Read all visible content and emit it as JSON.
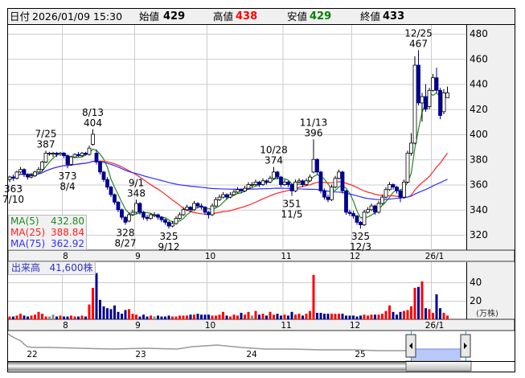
{
  "header": {
    "date_label": "日付",
    "datetime": "2026/01/09 15:30",
    "open_label": "始値",
    "open": "429",
    "high_label": "高値",
    "high": "438",
    "low_label": "安値",
    "low": "429",
    "close_label": "終値",
    "close": "433"
  },
  "colors": {
    "up": "#ff0000",
    "down": "#000090",
    "flat": "#888888",
    "ma5": "#228822",
    "ma25": "#ff2020",
    "ma75": "#3030ff",
    "high_text": "#ff0000",
    "low_text": "#008000"
  },
  "legend": {
    "ma5_label": "MA(5)",
    "ma5": "432.80",
    "ma25_label": "MA(25)",
    "ma25": "388.84",
    "ma75_label": "MA(75)",
    "ma75": "362.92"
  },
  "volume_legend": {
    "label": "出来高",
    "value": "41,600株"
  },
  "chart_data": {
    "type": "candlestick",
    "price_axis": {
      "ticks": [
        480,
        460,
        440,
        420,
        400,
        380,
        360,
        340,
        320
      ],
      "ylim": [
        320,
        480
      ]
    },
    "volume_axis": {
      "ticks": [
        40,
        20
      ],
      "unit": "(万株)"
    },
    "month_ticks": [
      {
        "label": "8",
        "index": 15
      },
      {
        "label": "9",
        "index": 35
      },
      {
        "label": "10",
        "index": 55
      },
      {
        "label": "11",
        "index": 76
      },
      {
        "label": "12",
        "index": 95
      },
      {
        "label": "26/1",
        "index": 117
      }
    ],
    "grid": true,
    "candles": [
      [
        364,
        367,
        362,
        366
      ],
      [
        366,
        368,
        363,
        365
      ],
      [
        365,
        371,
        364,
        370
      ],
      [
        370,
        374,
        369,
        372
      ],
      [
        372,
        373,
        366,
        368
      ],
      [
        368,
        369,
        364,
        366
      ],
      [
        366,
        369,
        365,
        367
      ],
      [
        367,
        371,
        366,
        370
      ],
      [
        370,
        374,
        369,
        372
      ],
      [
        372,
        379,
        371,
        378
      ],
      [
        378,
        387,
        377,
        385
      ],
      [
        385,
        386,
        383,
        385
      ],
      [
        385,
        386,
        382,
        385
      ],
      [
        385,
        386,
        382,
        384
      ],
      [
        384,
        386,
        383,
        385
      ],
      [
        385,
        386,
        381,
        383
      ],
      [
        383,
        384,
        373,
        376
      ],
      [
        376,
        383,
        375,
        382
      ],
      [
        382,
        385,
        381,
        384
      ],
      [
        384,
        386,
        382,
        383
      ],
      [
        383,
        386,
        382,
        385
      ],
      [
        385,
        386,
        383,
        384
      ],
      [
        384,
        391,
        383,
        389
      ],
      [
        392,
        404,
        391,
        400
      ],
      [
        385,
        388,
        376,
        378
      ],
      [
        378,
        379,
        368,
        370
      ],
      [
        370,
        371,
        362,
        364
      ],
      [
        364,
        366,
        356,
        358
      ],
      [
        358,
        359,
        350,
        352
      ],
      [
        352,
        353,
        344,
        346
      ],
      [
        346,
        347,
        338,
        340
      ],
      [
        340,
        341,
        332,
        334
      ],
      [
        334,
        335,
        328,
        330
      ],
      [
        331,
        338,
        330,
        336
      ],
      [
        336,
        340,
        335,
        338
      ],
      [
        338,
        348,
        337,
        345
      ],
      [
        345,
        346,
        336,
        338
      ],
      [
        338,
        339,
        332,
        334
      ],
      [
        334,
        336,
        331,
        333
      ],
      [
        333,
        337,
        332,
        336
      ],
      [
        336,
        338,
        334,
        336
      ],
      [
        336,
        337,
        332,
        334
      ],
      [
        334,
        335,
        330,
        332
      ],
      [
        332,
        333,
        328,
        330
      ],
      [
        330,
        331,
        325,
        327
      ],
      [
        327,
        331,
        326,
        329
      ],
      [
        329,
        335,
        328,
        333
      ],
      [
        333,
        338,
        332,
        336
      ],
      [
        336,
        342,
        335,
        340
      ],
      [
        340,
        344,
        339,
        342
      ],
      [
        342,
        343,
        338,
        340
      ],
      [
        340,
        347,
        339,
        345
      ],
      [
        345,
        346,
        341,
        343
      ],
      [
        343,
        345,
        340,
        342
      ],
      [
        342,
        343,
        336,
        338
      ],
      [
        338,
        339,
        333,
        336
      ],
      [
        336,
        345,
        335,
        343
      ],
      [
        343,
        350,
        342,
        348
      ],
      [
        348,
        352,
        347,
        350
      ],
      [
        350,
        354,
        349,
        352
      ],
      [
        352,
        353,
        348,
        350
      ],
      [
        350,
        354,
        349,
        352
      ],
      [
        352,
        356,
        351,
        354
      ],
      [
        354,
        358,
        353,
        356
      ],
      [
        356,
        357,
        353,
        355
      ],
      [
        355,
        359,
        354,
        357
      ],
      [
        357,
        362,
        356,
        360
      ],
      [
        360,
        362,
        358,
        360
      ],
      [
        360,
        364,
        359,
        362
      ],
      [
        362,
        363,
        358,
        360
      ],
      [
        360,
        365,
        359,
        363
      ],
      [
        363,
        364,
        360,
        362
      ],
      [
        362,
        367,
        361,
        365
      ],
      [
        365,
        374,
        364,
        370
      ],
      [
        370,
        371,
        364,
        366
      ],
      [
        366,
        367,
        358,
        360
      ],
      [
        360,
        364,
        359,
        362
      ],
      [
        362,
        363,
        358,
        360
      ],
      [
        360,
        361,
        351,
        355
      ],
      [
        355,
        364,
        354,
        362
      ],
      [
        362,
        365,
        361,
        363
      ],
      [
        363,
        364,
        358,
        360
      ],
      [
        360,
        365,
        359,
        363
      ],
      [
        363,
        368,
        362,
        366
      ],
      [
        370,
        396,
        369,
        380
      ],
      [
        380,
        381,
        368,
        370
      ],
      [
        370,
        371,
        353,
        355
      ],
      [
        355,
        357,
        348,
        350
      ],
      [
        350,
        352,
        346,
        348
      ],
      [
        348,
        360,
        347,
        358
      ],
      [
        358,
        367,
        357,
        365
      ],
      [
        365,
        372,
        364,
        370
      ],
      [
        370,
        371,
        353,
        355
      ],
      [
        355,
        356,
        336,
        338
      ],
      [
        338,
        340,
        335,
        337
      ],
      [
        337,
        339,
        333,
        335
      ],
      [
        335,
        336,
        328,
        330
      ],
      [
        330,
        331,
        325,
        328
      ],
      [
        328,
        340,
        327,
        338
      ],
      [
        338,
        342,
        337,
        340
      ],
      [
        340,
        345,
        339,
        343
      ],
      [
        343,
        344,
        336,
        338
      ],
      [
        338,
        347,
        337,
        345
      ],
      [
        345,
        352,
        344,
        350
      ],
      [
        350,
        358,
        349,
        356
      ],
      [
        356,
        362,
        355,
        360
      ],
      [
        360,
        361,
        356,
        358
      ],
      [
        358,
        359,
        353,
        355
      ],
      [
        355,
        356,
        346,
        350
      ],
      [
        350,
        364,
        349,
        362
      ],
      [
        362,
        387,
        361,
        385
      ],
      [
        385,
        401,
        383,
        393
      ],
      [
        393,
        462,
        392,
        455
      ],
      [
        455,
        467,
        423,
        425
      ],
      [
        425,
        433,
        410,
        430
      ],
      [
        430,
        440,
        418,
        420
      ],
      [
        422,
        437,
        420,
        435
      ],
      [
        435,
        448,
        434,
        445
      ],
      [
        445,
        453,
        433,
        435
      ],
      [
        435,
        437,
        412,
        415
      ],
      [
        418,
        436,
        416,
        433
      ],
      [
        429,
        438,
        429,
        433
      ]
    ],
    "volumes": [
      3,
      3,
      4,
      6,
      4,
      3,
      4,
      5,
      8,
      6,
      3,
      3,
      5,
      3,
      4,
      3,
      3,
      4,
      3,
      3,
      4,
      3,
      16,
      34,
      50,
      21,
      14,
      12,
      11,
      15,
      8,
      6,
      10,
      11,
      6,
      5,
      3,
      5,
      3,
      4,
      3,
      4,
      3,
      3,
      4,
      3,
      3,
      4,
      4,
      4,
      5,
      5,
      6,
      5,
      5,
      5,
      4,
      4,
      5,
      8,
      4,
      3,
      5,
      4,
      7,
      5,
      8,
      4,
      9,
      5,
      6,
      4,
      8,
      5,
      6,
      4,
      5,
      4,
      8,
      5,
      6,
      4,
      6,
      9,
      48,
      7,
      7,
      6,
      6,
      6,
      6,
      6,
      6,
      4,
      4,
      4,
      3,
      4,
      5,
      4,
      5,
      5,
      5,
      6,
      9,
      15,
      8,
      5,
      8,
      9,
      10,
      14,
      34,
      35,
      41,
      12,
      11,
      7,
      27,
      12,
      7,
      4
    ],
    "annotations": [
      {
        "date": "7/10",
        "value": "363",
        "index": 1,
        "type": "low"
      },
      {
        "date": "7/25",
        "value": "387",
        "index": 10,
        "type": "high"
      },
      {
        "date": "8/4",
        "value": "373",
        "index": 16,
        "type": "low"
      },
      {
        "date": "8/13",
        "value": "404",
        "index": 23,
        "type": "high"
      },
      {
        "date": "8/27",
        "value": "328",
        "index": 32,
        "type": "low"
      },
      {
        "date": "9/1",
        "value": "348",
        "index": 35,
        "type": "high"
      },
      {
        "date": "9/12",
        "value": "325",
        "index": 44,
        "type": "low"
      },
      {
        "date": "10/28",
        "value": "374",
        "index": 73,
        "type": "high"
      },
      {
        "date": "11/5",
        "value": "351",
        "index": 78,
        "type": "low"
      },
      {
        "date": "11/13",
        "value": "396",
        "index": 84,
        "type": "high"
      },
      {
        "date": "12/3",
        "value": "325",
        "index": 97,
        "type": "low"
      },
      {
        "date": "12/25",
        "value": "467",
        "index": 113,
        "type": "high"
      }
    ],
    "navigator": {
      "year_labels": [
        "22",
        "23",
        "24",
        "25"
      ]
    }
  }
}
